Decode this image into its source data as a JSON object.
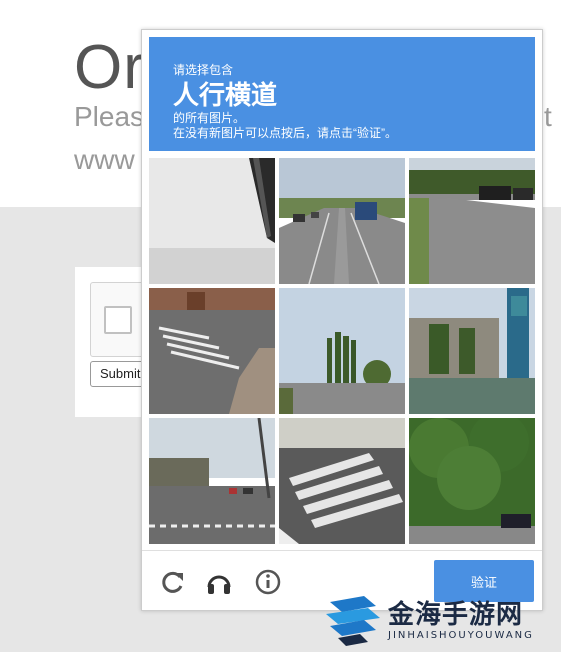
{
  "background": {
    "title": "Or",
    "subtitle": "Pleas",
    "subtitle_right": "t",
    "url": "www",
    "submit_label": "Submit"
  },
  "captcha": {
    "instruction_line1": "请选择包含",
    "target": "人行横道",
    "instruction_line3": "的所有图片。",
    "instruction_line4": "在没有新图片可以点按后，请点击“验证”。",
    "verify_label": "验证",
    "tiles": [
      {
        "row": 1,
        "col": 1,
        "content": "phone edge"
      },
      {
        "row": 1,
        "col": 2,
        "content": "highway road"
      },
      {
        "row": 1,
        "col": 3,
        "content": "street with car"
      },
      {
        "row": 2,
        "col": 1,
        "content": "crosswalk corner"
      },
      {
        "row": 2,
        "col": 2,
        "content": "palm trees street"
      },
      {
        "row": 2,
        "col": 3,
        "content": "building with sign"
      },
      {
        "row": 3,
        "col": 1,
        "content": "intersection crosswalk"
      },
      {
        "row": 3,
        "col": 2,
        "content": "crosswalk close-up"
      },
      {
        "row": 3,
        "col": 3,
        "content": "trees with car"
      }
    ],
    "icons": [
      "reload-icon",
      "headphones-icon",
      "info-icon"
    ]
  },
  "watermark": {
    "cn": "金海手游网",
    "en": "JINHAISHOUYOUWANG"
  },
  "colors": {
    "accent": "#4a90e2",
    "background_gray": "#e6e6e6",
    "watermark": "#1b2a44"
  }
}
